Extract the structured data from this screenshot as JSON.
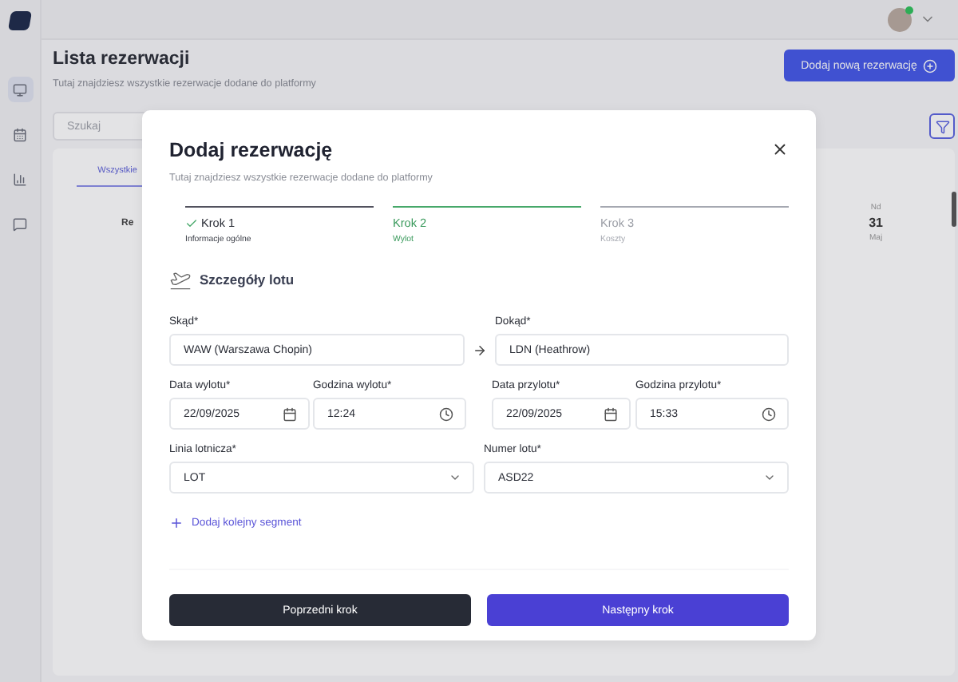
{
  "sidebar": {
    "items": [
      {
        "selected": true
      },
      {
        "selected": false
      },
      {
        "selected": false
      },
      {
        "selected": false
      }
    ]
  },
  "header": {
    "avatar": {
      "online": true
    }
  },
  "page": {
    "title": "Lista rezerwacji",
    "subtitle": "Tutaj znajdziesz wszystkie rezerwacje dodane do platformy",
    "add_button": "Dodaj nową rezerwację",
    "search": {
      "placeholder": "Szukaj"
    },
    "tabs": [
      {
        "label": "Wszystkie",
        "selected": true
      }
    ],
    "list": {
      "row_label": "Re",
      "date": {
        "weekday": "Nd",
        "day": "31",
        "month": "Maj"
      }
    }
  },
  "modal": {
    "title": "Dodaj rezerwację",
    "subtitle": "Tutaj znajdziesz wszystkie rezerwacje dodane do platformy",
    "steps": [
      {
        "title": "Krok 1",
        "subtitle": "Informacje ogólne",
        "completed": true,
        "selected": false
      },
      {
        "title": "Krok 2",
        "subtitle": "Wylot",
        "completed": false,
        "selected": true
      },
      {
        "title": "Krok 3",
        "subtitle": "Koszty",
        "completed": false,
        "selected": false
      }
    ],
    "section_title": "Szczegóły lotu",
    "route": {
      "from": {
        "label": "Skąd*",
        "value": "WAW (Warszawa Chopin)"
      },
      "to": {
        "label": "Dokąd*",
        "value": "LDN (Heathrow)"
      }
    },
    "times": [
      {
        "label": "Data wylotu*",
        "value": "22/09/2025",
        "kind": "date"
      },
      {
        "label": "Godzina wylotu*",
        "value": "12:24",
        "kind": "time"
      },
      {
        "label": "Data przylotu*",
        "value": "22/09/2025",
        "kind": "date"
      },
      {
        "label": "Godzina przylotu*",
        "value": "15:33",
        "kind": "time"
      }
    ],
    "selects": [
      {
        "label": "Linia lotnicza*",
        "value": "LOT"
      },
      {
        "label": "Numer lotu*",
        "value": "ASD22"
      }
    ],
    "add_segment": "Dodaj kolejny segment",
    "buttons": [
      {
        "label": "Poprzedni krok",
        "kind": "secondary"
      },
      {
        "label": "Następny krok",
        "kind": "primary"
      }
    ]
  }
}
